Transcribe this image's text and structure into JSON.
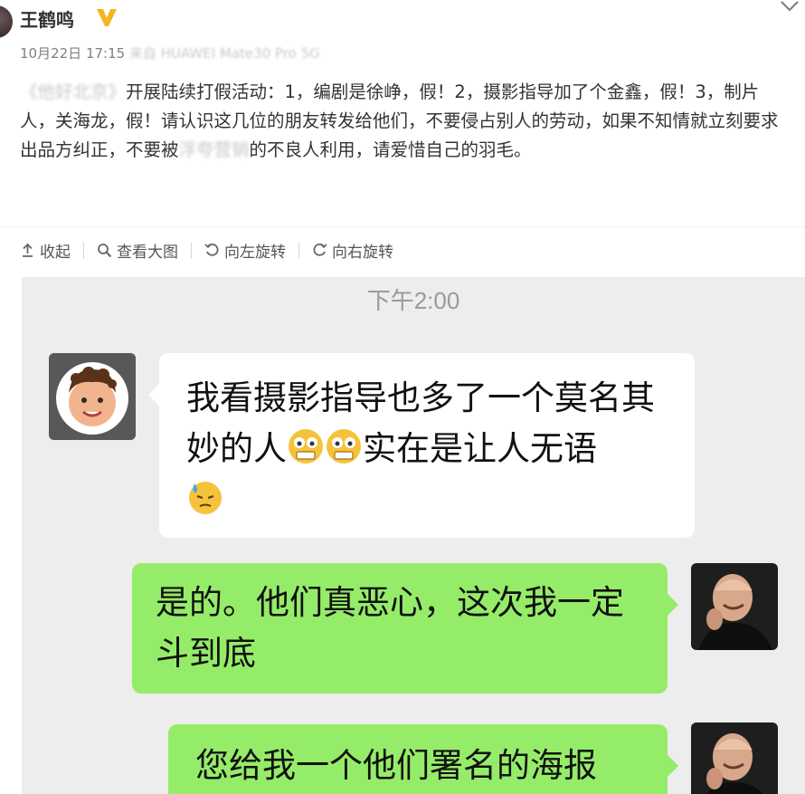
{
  "post": {
    "author": "王鹤鸣",
    "date": "10月22日 17:15",
    "source_blurred": "来自 HUAWEI Mate30 Pro 5G",
    "text_blurred_1": "《他好北京》",
    "text_1": "开展陆续打假活动：1，编剧是徐峥，假！2，摄影指导加了个金鑫，假！3，制片人，关海龙，假！请认识这几位的朋友转发给他们，不要侵占别人的劳动，如果不知情就立刻要求出品方纠正，不要被",
    "text_blurred_2": "浮夸营销",
    "text_2": "的不良人利用，请爱惜自己的羽毛。"
  },
  "toolbar": {
    "collapse": "收起",
    "view_large": "查看大图",
    "rotate_left": "向左旋转",
    "rotate_right": "向右旋转"
  },
  "chat": {
    "time": "下午2:00",
    "messages": [
      {
        "side": "left",
        "text_a": "我看摄影指导也多了一个莫名其妙的人",
        "emojis_a": [
          "grimace-emoji",
          "grimace-emoji"
        ],
        "text_b": "实在是让人无语",
        "emojis_b": [
          "sweat-emoji"
        ]
      },
      {
        "side": "right",
        "text": "是的。他们真恶心，这次我一定斗到底"
      },
      {
        "side": "right",
        "text": "您给我一个他们署名的海报"
      }
    ]
  },
  "colors": {
    "chat_bg": "#ededed",
    "bubble_green": "#95ec69",
    "verified_gold": "#f6b51f"
  }
}
